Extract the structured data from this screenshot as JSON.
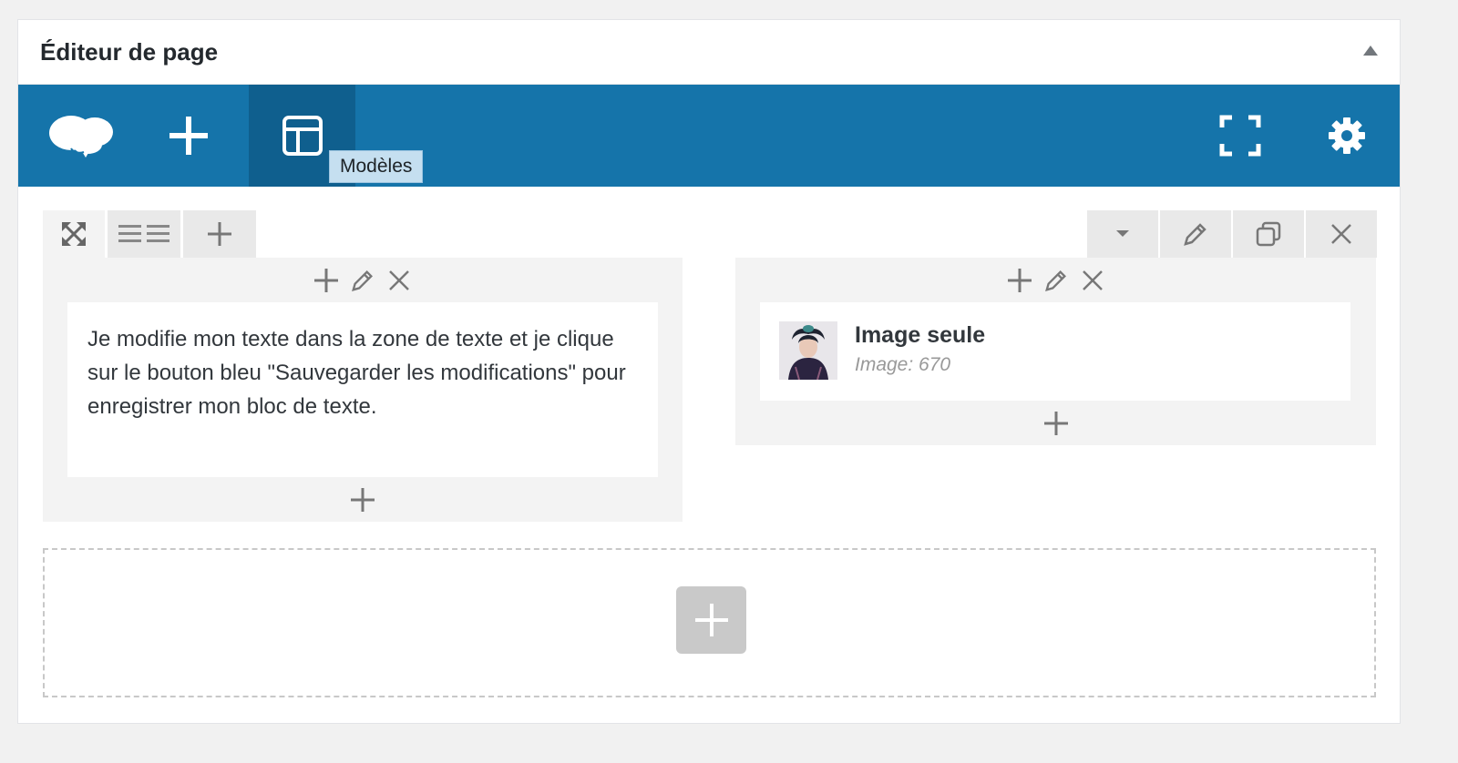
{
  "panel": {
    "title": "Éditeur de page"
  },
  "toolbar": {
    "logo_icon": "siteorigin-cloud-logo-icon",
    "add_icon": "plus-icon",
    "layouts_icon": "layout-icon",
    "tooltip": "Modèles",
    "fullscreen_icon": "fullscreen-icon",
    "settings_icon": "gear-icon",
    "background_color": "#1574aa",
    "active_color": "#0f5f8e"
  },
  "row_tools": {
    "left": [
      "move-icon",
      "columns-icon",
      "plus-icon"
    ],
    "right": [
      "caret-down-icon",
      "pencil-icon",
      "duplicate-icon",
      "close-icon"
    ]
  },
  "cells": [
    {
      "widget": {
        "type": "text",
        "text": "Je modifie mon texte dans la zone de texte et je clique sur le bouton bleu \"Sauvegarder les modifications\" pour enregistrer mon bloc de texte."
      }
    },
    {
      "widget": {
        "type": "image",
        "title": "Image seule",
        "subtitle": "Image: 670"
      }
    }
  ]
}
